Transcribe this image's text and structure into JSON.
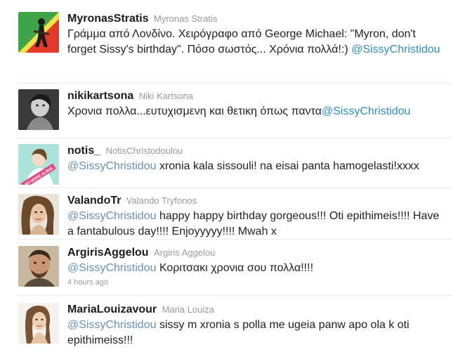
{
  "tweets": [
    {
      "screen_name": "MyronasStratis",
      "full_name": "Myronas Stratis",
      "text_before": "Γράμμα από Λονδίνο. Χειρόγραφο από George Michael: \"Myron, don't forget Sissy's birthday\". Πόσο σωστός... Χρόνια πολλά!:) ",
      "mention": "@SissyChristidou",
      "text_after": "",
      "timestamp": ""
    },
    {
      "screen_name": "nikikartsona",
      "full_name": "Niki Kartsona",
      "text_before": "Χρονια πολλα...ευτυχισμενη και θετικη όπως παντα",
      "mention": "@SissyChristidou",
      "text_after": "",
      "timestamp": ""
    },
    {
      "screen_name": "notis_",
      "full_name": "NotisChristodoulou",
      "text_before": "",
      "mention": "@SissyChristidou",
      "text_after": " xronia kala sissouli! na eisai panta hamogelasti!xxxx",
      "timestamp": "",
      "avatar_caption": "NO MORE ALIBIS"
    },
    {
      "screen_name": "ValandoTr",
      "full_name": "Valando Tryfonos",
      "text_before": "",
      "mention": "@SissyChristidou",
      "text_after": " happy happy birthday gorgeous!!! Oti epithimeis!!!! Have a fantabulous day!!!! Enjoyyyyy!!!! Mwah x",
      "timestamp": ""
    },
    {
      "screen_name": "ArgirisAggelou",
      "full_name": "Argiris Aggelou",
      "text_before": "",
      "mention": "@SissyChristidou",
      "text_after": " Κοριτσακι χρονια σου πολλα!!!!",
      "timestamp": "4 hours ago"
    },
    {
      "screen_name": "MariaLouizavour",
      "full_name": "Maria Louiza",
      "text_before": "",
      "mention": "@SissyChristidou",
      "text_after": " sissy m xronia s polla me ugeia panw apo ola k oti epithimeiss!!!",
      "timestamp": ""
    }
  ],
  "colors": {
    "mention_link": "#2f8dba",
    "mention_visited": "#6a8fb0",
    "screen_name": "#1b1b1b",
    "muted": "#999999",
    "divider": "#ebebeb"
  }
}
